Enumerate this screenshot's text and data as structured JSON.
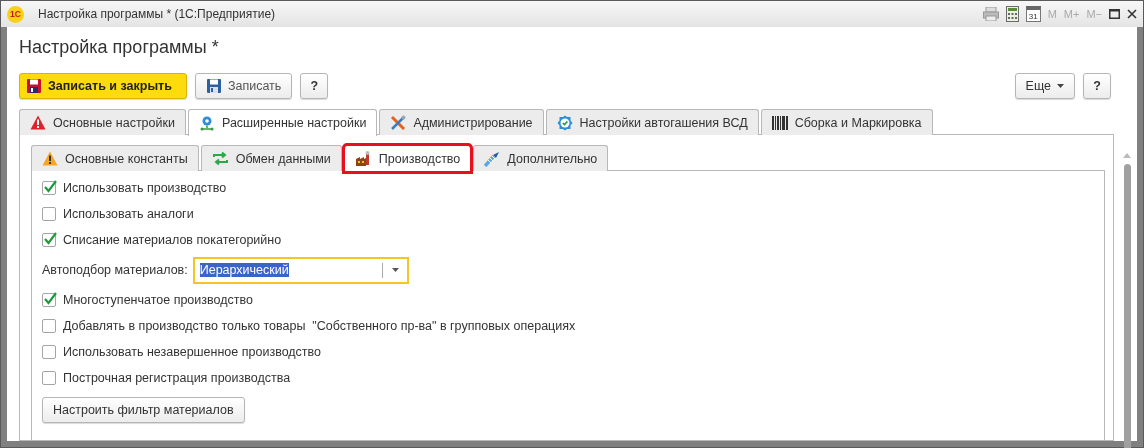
{
  "window": {
    "logo": "1С",
    "title": "Настройка программы * (1С:Предприятие)",
    "calendar_day": "31",
    "memory_buttons": [
      {
        "label": "M",
        "disabled": true
      },
      {
        "label": "M+",
        "disabled": true
      },
      {
        "label": "M−",
        "disabled": true
      }
    ]
  },
  "heading": "Настройка программы *",
  "toolbar": {
    "buttons": [
      {
        "label": "Записать и закрыть",
        "kind": "primary"
      },
      {
        "label": "Записать",
        "kind": "save"
      },
      {
        "label": "?",
        "kind": "help"
      }
    ],
    "right_buttons": [
      {
        "label": "Еще",
        "kind": "menu"
      },
      {
        "label": "?",
        "kind": "help"
      }
    ]
  },
  "tabs": [
    {
      "label": "Основные настройки",
      "selected": false
    },
    {
      "label": "Расширенные настройки",
      "selected": true
    },
    {
      "label": "Администрирование",
      "selected": false
    },
    {
      "label": "Настройки автогашения ВСД",
      "selected": false
    },
    {
      "label": "Сборка и Маркировка",
      "selected": false
    }
  ],
  "subtabs": [
    {
      "label": "Основные константы",
      "selected": false,
      "highlighted": false
    },
    {
      "label": "Обмен данными",
      "selected": false,
      "highlighted": false
    },
    {
      "label": "Производство",
      "selected": true,
      "highlighted": true
    },
    {
      "label": "Дополнительно",
      "selected": false,
      "highlighted": false
    }
  ],
  "settings": [
    {
      "kind": "checkbox",
      "label": "Использовать производство",
      "checked": true
    },
    {
      "kind": "checkbox",
      "label": "Использовать аналоги",
      "checked": false
    },
    {
      "kind": "checkbox",
      "label": "Списание материалов покатегорийно",
      "checked": true
    },
    {
      "kind": "combo",
      "label": "Автоподбор материалов:",
      "value": "Иерархический",
      "focused": true
    },
    {
      "kind": "checkbox",
      "label": "Многоступенчатое производство",
      "checked": true
    },
    {
      "kind": "checkbox",
      "label": "Добавлять в производство только товары  \"Собственного пр-ва\" в групповых операциях",
      "checked": false
    },
    {
      "kind": "checkbox",
      "label": "Использовать незавершенное производство",
      "checked": false
    },
    {
      "kind": "checkbox",
      "label": "Построчная регистрация производства",
      "checked": false
    },
    {
      "kind": "button",
      "label": "Настроить фильтр материалов"
    }
  ]
}
